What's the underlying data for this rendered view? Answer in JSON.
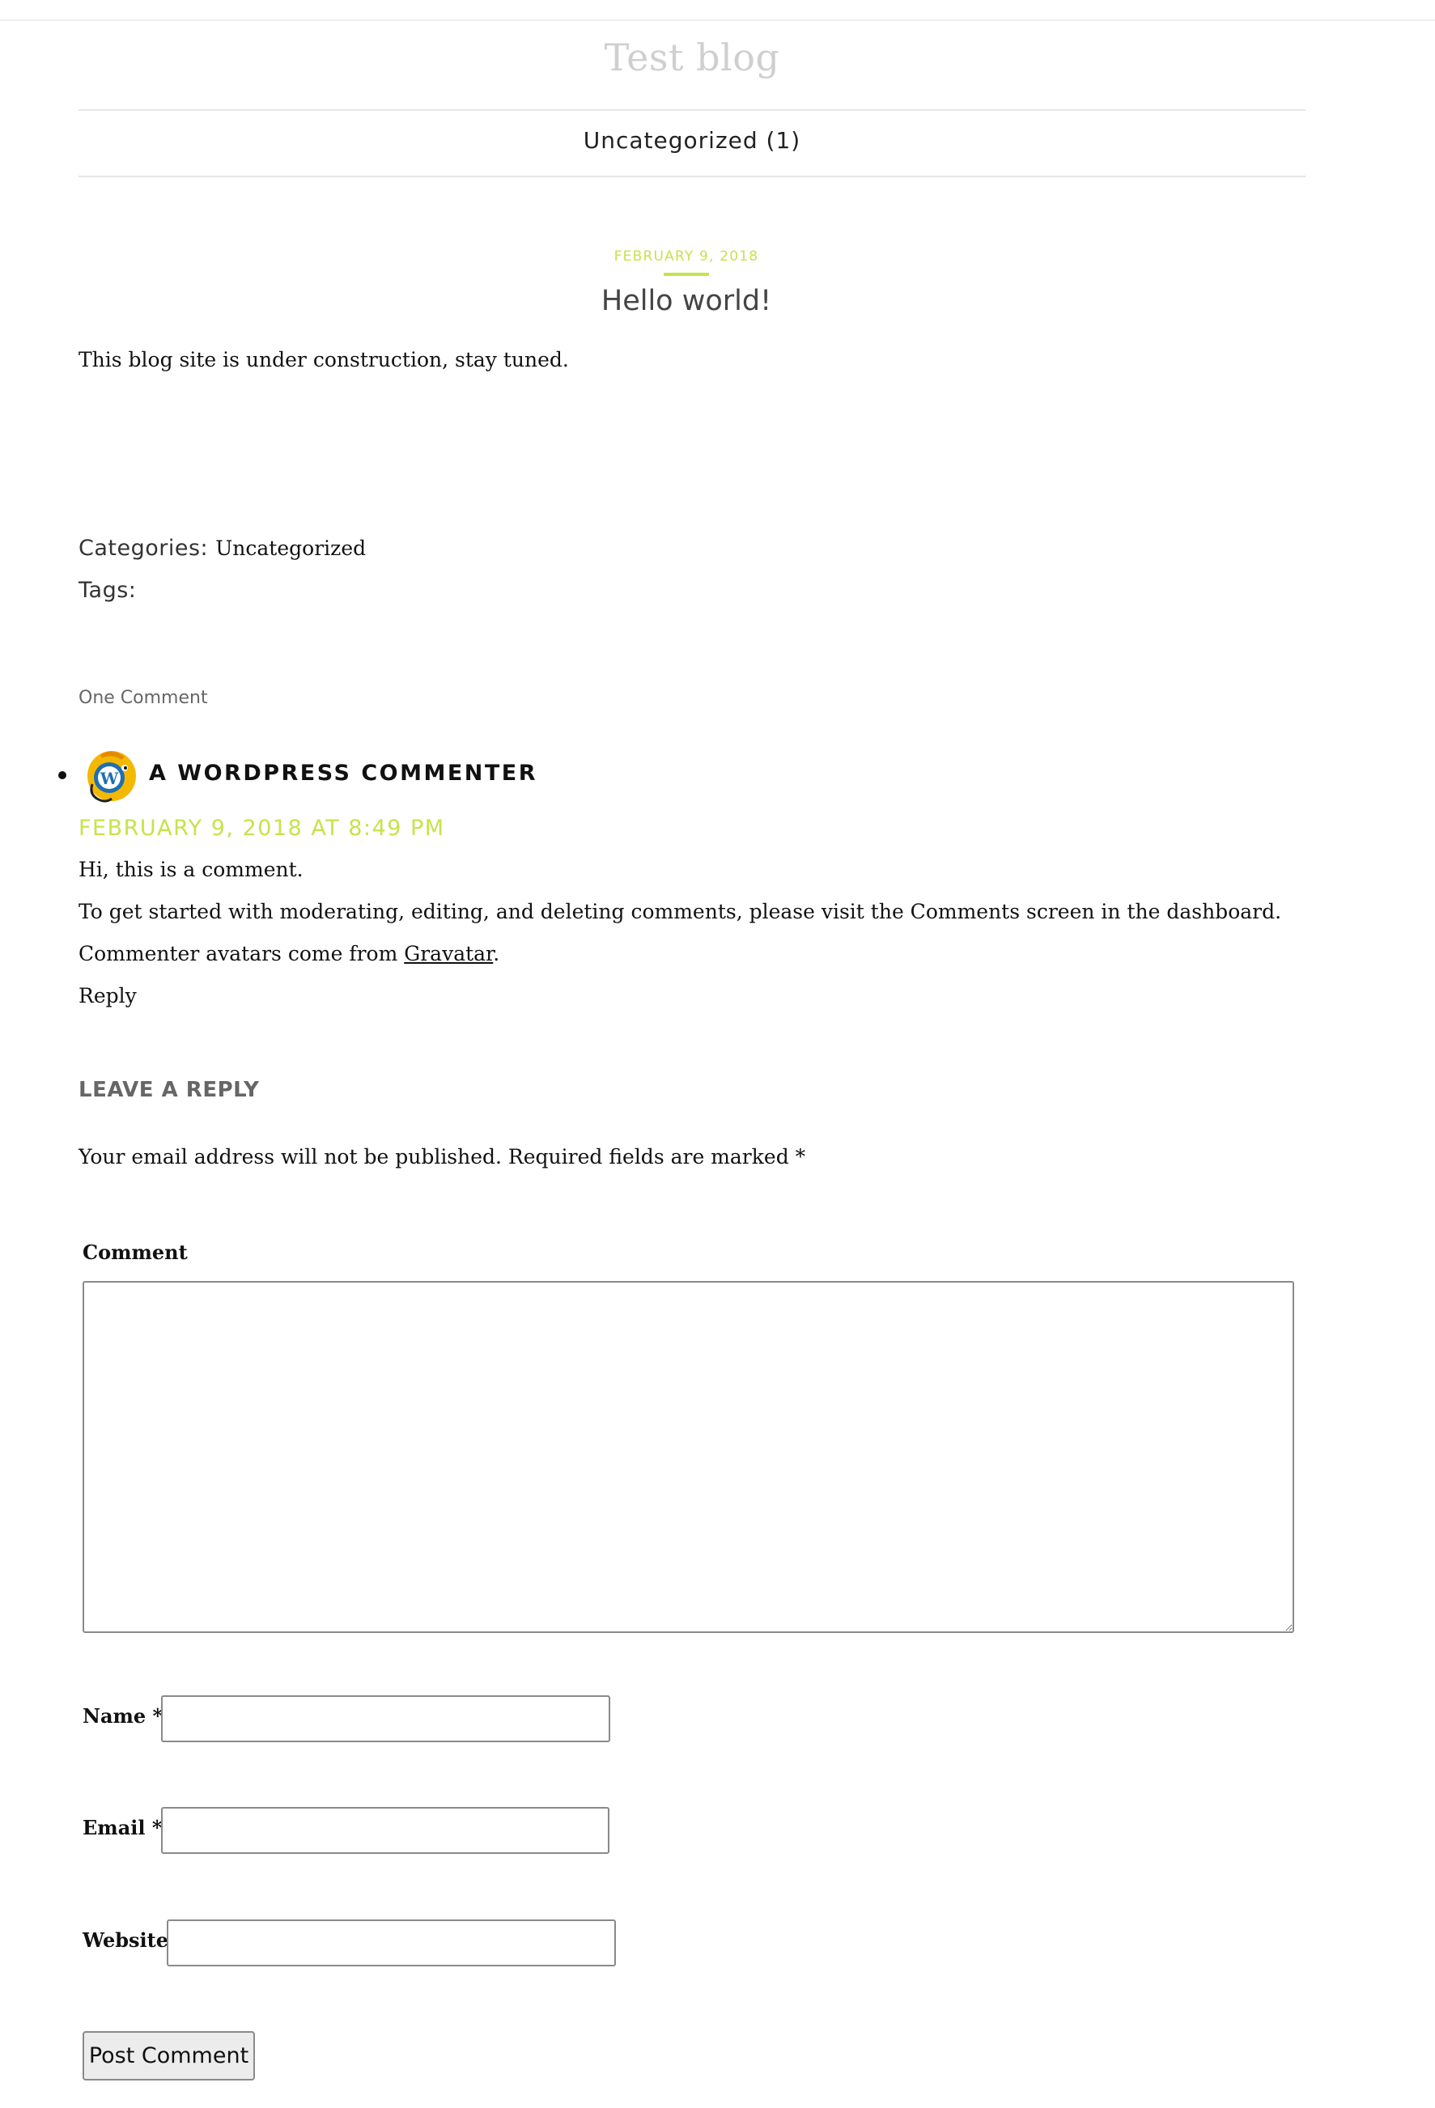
{
  "site": {
    "title": "Test blog"
  },
  "nav": {
    "items": [
      {
        "label": "Uncategorized (1)"
      }
    ]
  },
  "post": {
    "date": "FEBRUARY 9, 2018",
    "title": "Hello world!",
    "body": "This blog site is under construction, stay tuned.",
    "categories_label": "Categories:",
    "categories_value": "Uncategorized",
    "tags_label": "Tags:"
  },
  "comments": {
    "count_label": "One Comment",
    "items": [
      {
        "author": "A WORDPRESS COMMENTER",
        "date": "FEBRUARY 9, 2018 AT 8:49 PM",
        "line1": "Hi, this is a comment.",
        "line2": "To get started with moderating, editing, and deleting comments, please visit the Comments screen in the dashboard.",
        "line3_prefix": "Commenter avatars come from ",
        "line3_link": "Gravatar",
        "line3_suffix": ".",
        "reply": "Reply"
      }
    ]
  },
  "reply_form": {
    "heading": "LEAVE A REPLY",
    "notes": "Your email address will not be published. Required fields are marked *",
    "comment_label": "Comment",
    "comment_value": "",
    "name_label": "Name *",
    "name_value": "",
    "email_label": "Email *",
    "email_value": "",
    "website_label": "Website",
    "website_value": "",
    "submit_label": "Post Comment"
  },
  "colors": {
    "accent": "#c6e34a",
    "title": "#cfcfcf",
    "text": "#111111",
    "muted": "#666666"
  }
}
